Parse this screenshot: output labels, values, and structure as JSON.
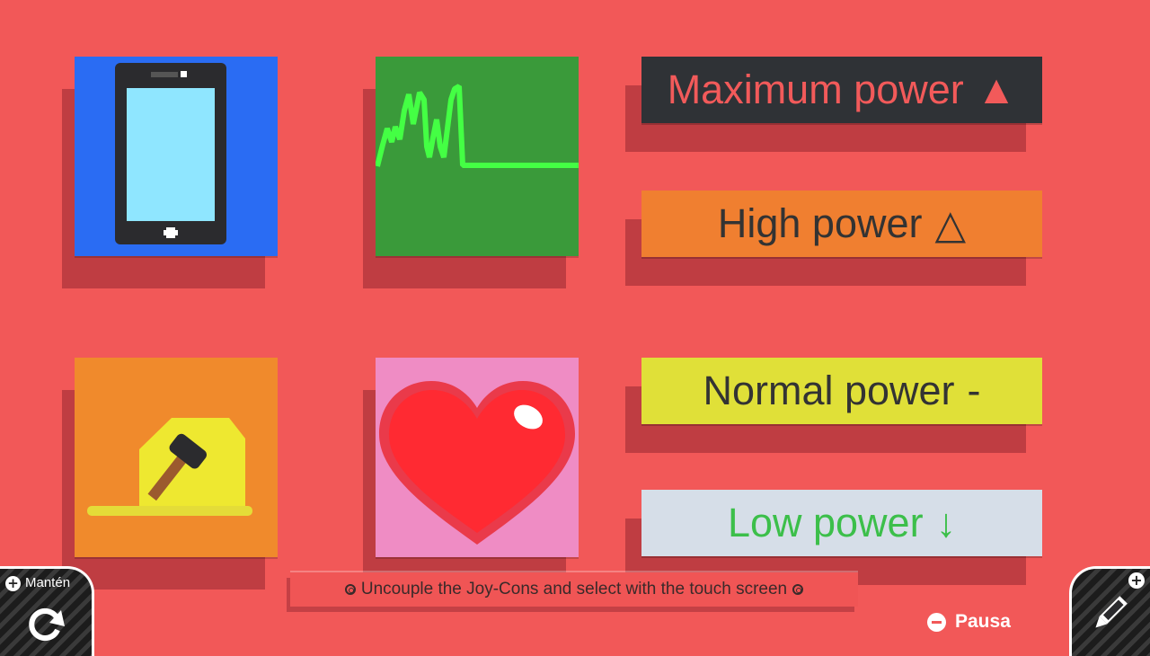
{
  "options": {
    "max": {
      "label": "Maximum power",
      "symbol": "▲"
    },
    "high": {
      "label": "High power",
      "symbol": "△"
    },
    "normal": {
      "label": "Normal power",
      "symbol": "-"
    },
    "low": {
      "label": "Low power",
      "symbol": "↓"
    }
  },
  "instruction": "Uncouple the Joy-Cons and select with the touch screen",
  "hold": {
    "plus": "+",
    "label": "Mantén"
  },
  "pause": {
    "label": "Pausa"
  },
  "draw": {
    "plus": "+"
  },
  "tiles": [
    "phone-picture",
    "waveform-picture",
    "bell-hammer-picture",
    "heart-picture"
  ],
  "colors": {
    "background": "#f25858",
    "max_bg": "#2f3236",
    "high_bg": "#f07f30",
    "normal_bg": "#e0e038",
    "low_bg": "#d6dee8"
  }
}
